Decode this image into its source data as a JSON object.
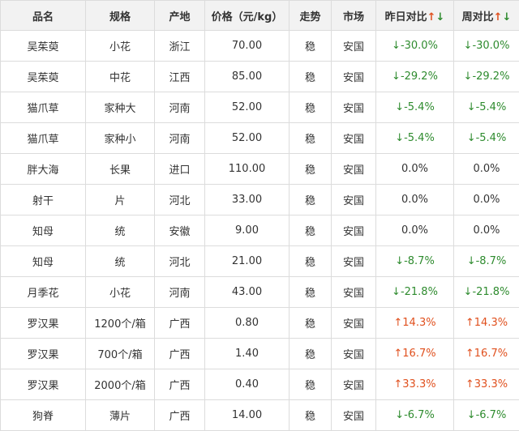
{
  "colors": {
    "up": "#e0501e",
    "down": "#2e8b2e",
    "header_bg": "#f2f2f2",
    "border": "#dcdcdc"
  },
  "header": {
    "name": "品名",
    "spec": "规格",
    "origin": "产地",
    "price": "价格（元/kg）",
    "trend": "走势",
    "market": "市场",
    "day_change": "昨日对比",
    "week_change": "周对比",
    "arrow_up": "↑",
    "arrow_down": "↓"
  },
  "rows": [
    {
      "name": "吴茱萸",
      "spec": "小花",
      "origin": "浙江",
      "price": "70.00",
      "trend": "稳",
      "market": "安国",
      "day": "↓-30.0%",
      "week": "↓-30.0%",
      "dir": "down"
    },
    {
      "name": "吴茱萸",
      "spec": "中花",
      "origin": "江西",
      "price": "85.00",
      "trend": "稳",
      "market": "安国",
      "day": "↓-29.2%",
      "week": "↓-29.2%",
      "dir": "down"
    },
    {
      "name": "猫爪草",
      "spec": "家种大",
      "origin": "河南",
      "price": "52.00",
      "trend": "稳",
      "market": "安国",
      "day": "↓-5.4%",
      "week": "↓-5.4%",
      "dir": "down"
    },
    {
      "name": "猫爪草",
      "spec": "家种小",
      "origin": "河南",
      "price": "52.00",
      "trend": "稳",
      "market": "安国",
      "day": "↓-5.4%",
      "week": "↓-5.4%",
      "dir": "down"
    },
    {
      "name": "胖大海",
      "spec": "长果",
      "origin": "进口",
      "price": "110.00",
      "trend": "稳",
      "market": "安国",
      "day": "0.0%",
      "week": "0.0%",
      "dir": "flat"
    },
    {
      "name": "射干",
      "spec": "片",
      "origin": "河北",
      "price": "33.00",
      "trend": "稳",
      "market": "安国",
      "day": "0.0%",
      "week": "0.0%",
      "dir": "flat"
    },
    {
      "name": "知母",
      "spec": "统",
      "origin": "安徽",
      "price": "9.00",
      "trend": "稳",
      "market": "安国",
      "day": "0.0%",
      "week": "0.0%",
      "dir": "flat"
    },
    {
      "name": "知母",
      "spec": "统",
      "origin": "河北",
      "price": "21.00",
      "trend": "稳",
      "market": "安国",
      "day": "↓-8.7%",
      "week": "↓-8.7%",
      "dir": "down"
    },
    {
      "name": "月季花",
      "spec": "小花",
      "origin": "河南",
      "price": "43.00",
      "trend": "稳",
      "market": "安国",
      "day": "↓-21.8%",
      "week": "↓-21.8%",
      "dir": "down"
    },
    {
      "name": "罗汉果",
      "spec": "1200个/箱",
      "origin": "广西",
      "price": "0.80",
      "trend": "稳",
      "market": "安国",
      "day": "↑14.3%",
      "week": "↑14.3%",
      "dir": "up"
    },
    {
      "name": "罗汉果",
      "spec": "700个/箱",
      "origin": "广西",
      "price": "1.40",
      "trend": "稳",
      "market": "安国",
      "day": "↑16.7%",
      "week": "↑16.7%",
      "dir": "up"
    },
    {
      "name": "罗汉果",
      "spec": "2000个/箱",
      "origin": "广西",
      "price": "0.40",
      "trend": "稳",
      "market": "安国",
      "day": "↑33.3%",
      "week": "↑33.3%",
      "dir": "up"
    },
    {
      "name": "狗脊",
      "spec": "薄片",
      "origin": "广西",
      "price": "14.00",
      "trend": "稳",
      "market": "安国",
      "day": "↓-6.7%",
      "week": "↓-6.7%",
      "dir": "down"
    }
  ]
}
